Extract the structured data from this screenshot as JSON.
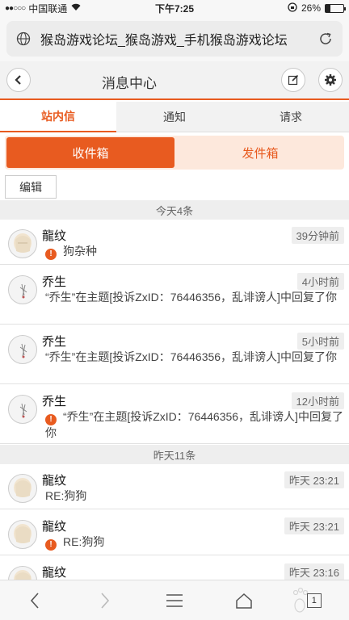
{
  "status_bar": {
    "carrier": "中国联通",
    "time": "下午7:25",
    "battery": "26%",
    "battery_level": 0.26
  },
  "url_bar": {
    "title": "猴岛游戏论坛_猴岛游戏_手机猴岛游戏论坛"
  },
  "header": {
    "title": "消息中心"
  },
  "tabs": [
    {
      "label": "站内信",
      "active": true
    },
    {
      "label": "通知",
      "active": false
    },
    {
      "label": "请求",
      "active": false
    }
  ],
  "mailbox": {
    "inbox_label": "收件箱",
    "outbox_label": "发件箱"
  },
  "edit_label": "编辑",
  "sections": {
    "today": "今天4条",
    "yesterday": "昨天11条"
  },
  "messages": [
    {
      "sender": "龍纹",
      "time": "39分钟前",
      "body": "狗杂种",
      "alert": true
    },
    {
      "sender": "乔生",
      "time": "4小时前",
      "body": "“乔生”在主题[投诉ZxID：76446356，乱诽谤人]中回复了你",
      "alert": false
    },
    {
      "sender": "乔生",
      "time": "5小时前",
      "body": "“乔生”在主题[投诉ZxID：76446356，乱诽谤人]中回复了你",
      "alert": false
    },
    {
      "sender": "乔生",
      "time": "12小时前",
      "body": "“乔生”在主题[投诉ZxID：76446356，乱诽谤人]中回复了你",
      "alert": true
    },
    {
      "sender": "龍纹",
      "time": "昨天 23:21",
      "body": "RE:狗狗",
      "alert": false
    },
    {
      "sender": "龍纹",
      "time": "昨天 23:21",
      "body": "RE:狗狗",
      "alert": true
    },
    {
      "sender": "龍纹",
      "time": "昨天 23:16",
      "body": "",
      "alert": false
    }
  ],
  "toolbar": {
    "tab_count": "1"
  },
  "colors": {
    "accent": "#e85b20",
    "accent_light": "#fde8dc"
  }
}
